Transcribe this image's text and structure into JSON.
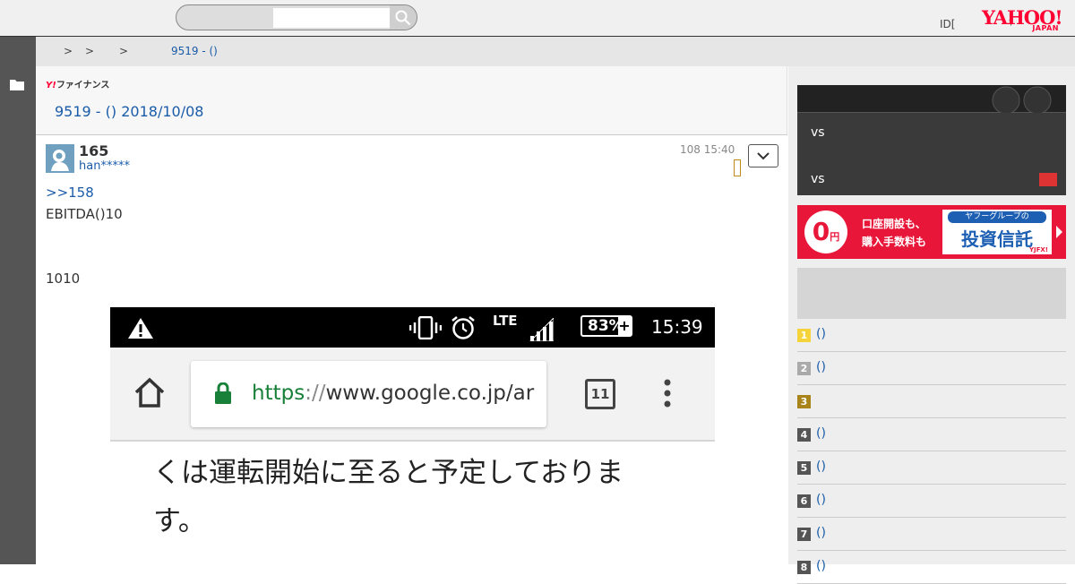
{
  "header": {
    "search_placeholder": "",
    "login_text": "ID[",
    "login_mark": "†",
    "logo_main": "YAHOO!",
    "logo_sub": "JAPAN"
  },
  "breadcrumb": {
    "sep1": ">",
    "sep2": ">",
    "sep3": ">",
    "current": "9519 - ()"
  },
  "main": {
    "fin_logo_y": "Y!",
    "fin_logo_text": "ファイナンス",
    "page_title": "9519 - () 2018/10/08"
  },
  "post": {
    "number": "165",
    "user": "han*****",
    "time": "108 15:40",
    "reply_link": ">>158",
    "line1": "EBITDA()10",
    "line2": "1010"
  },
  "screenshot": {
    "lte": "LTE",
    "battery": "83%",
    "battery_plus": "+",
    "time": "15:39",
    "url_https": "https",
    "url_sep": "://",
    "url_rest": "www.google.co.jp/ar",
    "tabs_count": "11",
    "jp_line1": "くは運転開始に至ると予定しておりま",
    "jp_line2": "す。"
  },
  "sidebar": {
    "score_row1": "vs",
    "score_row2": "vs",
    "ad": {
      "zero": "0",
      "zero_unit": "円",
      "line1": "口座開設も、",
      "line2": "購入手数料も",
      "box_top": "ヤフーグループの",
      "box_main": "投資信託",
      "brand": "YJFX!"
    },
    "ranking": [
      {
        "rank": "1",
        "label": "()",
        "color": "#f5d33a"
      },
      {
        "rank": "2",
        "label": "()",
        "color": "#aaaaaa"
      },
      {
        "rank": "3",
        "label": "",
        "color": "#a8841a"
      },
      {
        "rank": "4",
        "label": "()",
        "color": "#555555"
      },
      {
        "rank": "5",
        "label": "()",
        "color": "#555555"
      },
      {
        "rank": "6",
        "label": "()",
        "color": "#555555"
      },
      {
        "rank": "7",
        "label": "()",
        "color": "#555555"
      },
      {
        "rank": "8",
        "label": "()",
        "color": "#555555"
      }
    ]
  }
}
